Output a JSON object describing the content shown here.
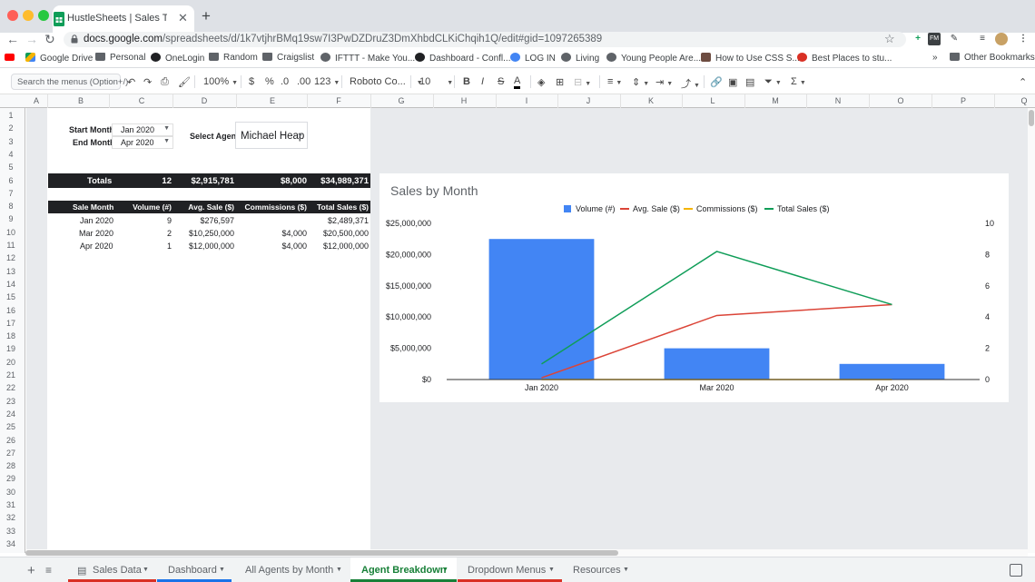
{
  "browser": {
    "tab_title": "HustleSheets | Sales Tracker v",
    "url_host": "docs.google.com",
    "url_path": "/spreadsheets/d/1k7vtjhrBMq19sw7I3PwDZDruZ3DmXhbdCLKiChqih1Q/edit#gid=1097265389",
    "bookmarks": [
      "Google Drive",
      "Personal",
      "OneLogin",
      "Random",
      "Craigslist",
      "IFTTT - Make You...",
      "Dashboard - Confl...",
      "LOG IN",
      "Living",
      "Young People Are...",
      "How to Use CSS S...",
      "Best Places to stu..."
    ],
    "other_bookmarks": "Other Bookmarks",
    "more_bookmarks": "»"
  },
  "toolbar": {
    "search_placeholder": "Search the menus (Option+/)",
    "zoom": "100%",
    "currency": "$",
    "percent": "%",
    "dec_less": ".0",
    "dec_more": ".00",
    "number_format": "123",
    "font": "Roboto Co...",
    "font_size": "10",
    "bold": "B",
    "italic": "I",
    "strike": "S",
    "text_color": "A",
    "sum": "Σ"
  },
  "grid": {
    "columns": [
      "A",
      "B",
      "C",
      "D",
      "E",
      "F",
      "G",
      "H",
      "I",
      "J",
      "K",
      "L",
      "M",
      "N",
      "O",
      "P",
      "Q"
    ],
    "rows": [
      "1",
      "2",
      "3",
      "4",
      "5",
      "6",
      "7",
      "8",
      "9",
      "10",
      "11",
      "12",
      "13",
      "14",
      "15",
      "16",
      "17",
      "18",
      "19",
      "20",
      "21",
      "22",
      "23",
      "24",
      "25",
      "26",
      "27",
      "28",
      "29",
      "30",
      "31",
      "32",
      "33",
      "34"
    ]
  },
  "filters": {
    "start_label": "Start Month",
    "start_value": "Jan 2020",
    "end_label": "End Month",
    "end_value": "Apr 2020",
    "agent_label": "Select Agent",
    "agent_value": "Michael Heap"
  },
  "totals": {
    "label": "Totals",
    "volume": "12",
    "avg_sale": "$2,915,781",
    "commissions": "$8,000",
    "total_sales": "$34,989,371"
  },
  "table": {
    "headers": [
      "Sale Month",
      "Volume (#)",
      "Avg. Sale ($)",
      "Commissions ($)",
      "Total Sales ($)"
    ],
    "rows": [
      [
        "Jan 2020",
        "9",
        "$276,597",
        "",
        "$2,489,371"
      ],
      [
        "Mar 2020",
        "2",
        "$10,250,000",
        "$4,000",
        "$20,500,000"
      ],
      [
        "Apr 2020",
        "1",
        "$12,000,000",
        "$4,000",
        "$12,000,000"
      ]
    ]
  },
  "chart_data": {
    "type": "bar",
    "title": "Sales by Month",
    "categories": [
      "Jan 2020",
      "Mar 2020",
      "Apr 2020"
    ],
    "series": [
      {
        "name": "Volume (#)",
        "type": "bar",
        "axis": "right",
        "color": "#4285f4",
        "values": [
          9,
          2,
          1
        ]
      },
      {
        "name": "Avg. Sale ($)",
        "type": "line",
        "axis": "left",
        "color": "#db4437",
        "values": [
          276597,
          10250000,
          12000000
        ]
      },
      {
        "name": "Commissions ($)",
        "type": "line",
        "axis": "left",
        "color": "#f4b400",
        "values": [
          0,
          4000,
          4000
        ]
      },
      {
        "name": "Total Sales ($)",
        "type": "line",
        "axis": "left",
        "color": "#0f9d58",
        "values": [
          2489371,
          20500000,
          12000000
        ]
      }
    ],
    "left_axis": {
      "min": 0,
      "max": 25000000,
      "ticks": [
        "$0",
        "$5,000,000",
        "$10,000,000",
        "$15,000,000",
        "$20,000,000",
        "$25,000,000"
      ]
    },
    "right_axis": {
      "min": 0,
      "max": 10,
      "ticks": [
        "0",
        "2",
        "4",
        "6",
        "8",
        "10"
      ]
    },
    "legend_position": "top",
    "grid": false
  },
  "sheet_tabs": [
    {
      "label": "Sales Data",
      "color": "#d93025",
      "active": false
    },
    {
      "label": "Dashboard",
      "color": "#1a73e8",
      "active": false
    },
    {
      "label": "All Agents by Month",
      "color": "",
      "active": false
    },
    {
      "label": "Agent Breakdown",
      "color": "#188038",
      "active": true
    },
    {
      "label": "Dropdown Menus",
      "color": "#d93025",
      "active": false
    },
    {
      "label": "Resources",
      "color": "",
      "active": false
    }
  ]
}
